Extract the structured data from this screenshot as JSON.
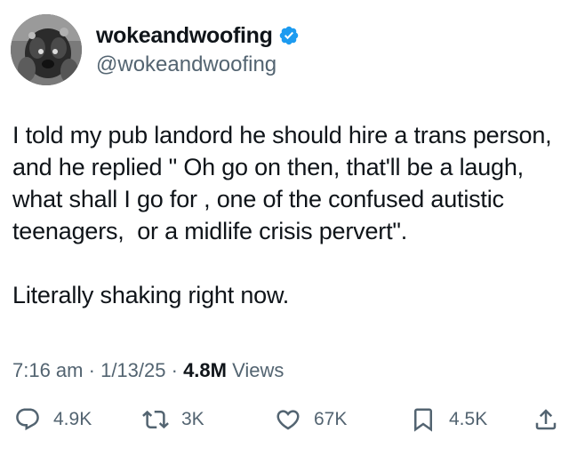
{
  "user": {
    "display_name": "wokeandwoofing",
    "handle": "@wokeandwoofing",
    "verified": true,
    "verified_color": "#1d9bf0"
  },
  "tweet": {
    "text": "I told my pub landord he should hire a trans person, and he replied \" Oh go on then, that'll be a laugh, what shall I go for , one of the confused autistic teenagers,  or a midlife crisis pervert\".\n\nLiterally shaking right now.",
    "time": "7:16 am",
    "date": "1/13/25",
    "views_count": "4.8M",
    "views_label": "Views",
    "separator": "·"
  },
  "actions": {
    "reply": {
      "icon": "reply-icon",
      "count": "4.9K"
    },
    "retweet": {
      "icon": "retweet-icon",
      "count": "3K"
    },
    "like": {
      "icon": "heart-icon",
      "count": "67K"
    },
    "bookmark": {
      "icon": "bookmark-icon",
      "count": "4.5K"
    },
    "share": {
      "icon": "share-icon"
    }
  },
  "colors": {
    "text": "#0f1419",
    "secondary": "#536471",
    "accent": "#1d9bf0"
  }
}
